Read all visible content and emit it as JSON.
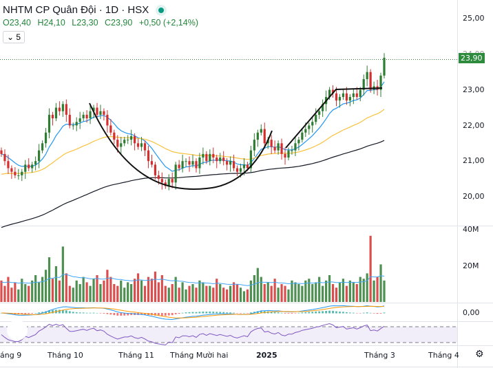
{
  "header": {
    "title": "NHTM CP Quân Đội · 1D · HSX",
    "open": "O23,40",
    "high": "H24,10",
    "low": "L23,30",
    "close": "C23,90",
    "change": "+0,50 (+2,14%)",
    "collapse_count": "5"
  },
  "price_axis": {
    "labels": [
      "25,00",
      "24,00",
      "23,00",
      "22,00",
      "21,00",
      "20,00"
    ],
    "last_price": "23,90"
  },
  "volume_axis": {
    "labels": [
      "40M",
      "20M"
    ]
  },
  "macd_axis": {
    "label": "0,00"
  },
  "time_axis": {
    "labels": [
      "áng 9",
      "Tháng 10",
      "Tháng 11",
      "Tháng Mười hai",
      "2025",
      "Tháng 3",
      "Tháng 4"
    ]
  },
  "colors": {
    "up": "#2e7d32",
    "down": "#d32f2f",
    "ma_short": "#2196f3",
    "ma_mid": "#f9c23c",
    "ma_long": "#131722",
    "rsi": "#7e57c2"
  },
  "chart_data": {
    "type": "candlestick",
    "ylim": [
      19.5,
      25.5
    ],
    "closes": [
      21.2,
      21.0,
      20.8,
      20.7,
      20.6,
      20.6,
      20.7,
      20.9,
      20.8,
      20.9,
      21.0,
      21.3,
      21.5,
      21.8,
      22.3,
      22.2,
      22.5,
      22.4,
      22.6,
      22.3,
      22.0,
      22.0,
      22.1,
      22.2,
      22.3,
      22.2,
      22.4,
      22.5,
      22.3,
      22.4,
      22.3,
      22.0,
      21.8,
      21.6,
      21.4,
      21.5,
      21.6,
      21.6,
      21.7,
      21.5,
      21.4,
      21.5,
      21.3,
      21.0,
      20.9,
      20.6,
      20.5,
      20.4,
      20.3,
      20.5,
      20.4,
      20.9,
      20.8,
      21.0,
      21.0,
      20.9,
      21.0,
      20.8,
      21.1,
      21.2,
      21.0,
      21.2,
      21.1,
      21.0,
      21.1,
      21.0,
      20.9,
      21.0,
      20.8,
      20.7,
      20.8,
      20.9,
      20.8,
      21.3,
      21.6,
      21.8,
      21.9,
      21.5,
      21.6,
      21.4,
      21.3,
      21.5,
      21.2,
      21.1,
      21.3,
      21.3,
      21.5,
      21.6,
      21.8,
      21.9,
      22.0,
      22.1,
      22.3,
      22.4,
      22.6,
      22.8,
      23.0,
      22.9,
      22.7,
      22.8,
      22.9,
      22.7,
      22.8,
      22.9,
      22.8,
      23.0,
      23.3,
      23.5,
      23.0,
      23.1,
      23.0,
      23.4,
      23.9
    ],
    "volumes_m": [
      12,
      9,
      14,
      8,
      11,
      7,
      13,
      10,
      9,
      12,
      15,
      11,
      14,
      18,
      25,
      13,
      20,
      12,
      31,
      16,
      9,
      8,
      12,
      10,
      14,
      11,
      9,
      13,
      15,
      10,
      12,
      18,
      14,
      10,
      9,
      12,
      8,
      11,
      10,
      13,
      16,
      12,
      9,
      14,
      13,
      17,
      11,
      15,
      9,
      8,
      10,
      14,
      8,
      11,
      7,
      9,
      10,
      8,
      12,
      11,
      9,
      9,
      8,
      13,
      10,
      8,
      7,
      9,
      11,
      10,
      8,
      6,
      7,
      12,
      15,
      19,
      14,
      10,
      11,
      9,
      13,
      8,
      10,
      9,
      7,
      12,
      11,
      10,
      9,
      12,
      13,
      10,
      11,
      14,
      9,
      12,
      15,
      10,
      8,
      11,
      13,
      9,
      12,
      11,
      10,
      14,
      13,
      16,
      37,
      12,
      14,
      21,
      12
    ]
  }
}
